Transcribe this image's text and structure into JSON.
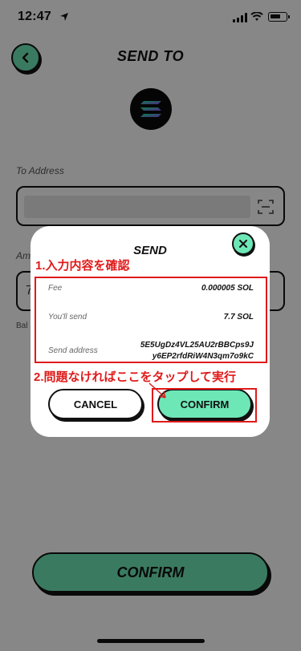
{
  "status_bar": {
    "time": "12:47"
  },
  "header": {
    "title": "SEND TO"
  },
  "form": {
    "to_address_label": "To Address",
    "amount_label": "Am",
    "amount_prefix": "7",
    "balance_label": "Bal"
  },
  "bottom_button": {
    "label": "CONFIRM"
  },
  "modal": {
    "title": "SEND",
    "rows": [
      {
        "label": "Fee",
        "value": "0.000005 SOL"
      },
      {
        "label": "You'll send",
        "value": "7.7 SOL"
      }
    ],
    "address_label": "Send address",
    "address_line1": "5E5UgDz4VL25AU2rBBCps9J",
    "address_line2": "y6EP2rfdRiW4N3qm7o9kC",
    "cancel_label": "CANCEL",
    "confirm_label": "CONFIRM"
  },
  "annotations": {
    "step1": "1.入力内容を確認",
    "step2": "2.問題なければここをタップして実行",
    "color": "#e01a1a"
  },
  "colors": {
    "accent": "#6ee7b7",
    "outline": "#111111"
  },
  "icons": [
    "location-arrow-icon",
    "signal-icon",
    "wifi-icon",
    "battery-icon",
    "back-arrow-icon",
    "solana-logo-icon",
    "scan-icon",
    "close-icon"
  ]
}
